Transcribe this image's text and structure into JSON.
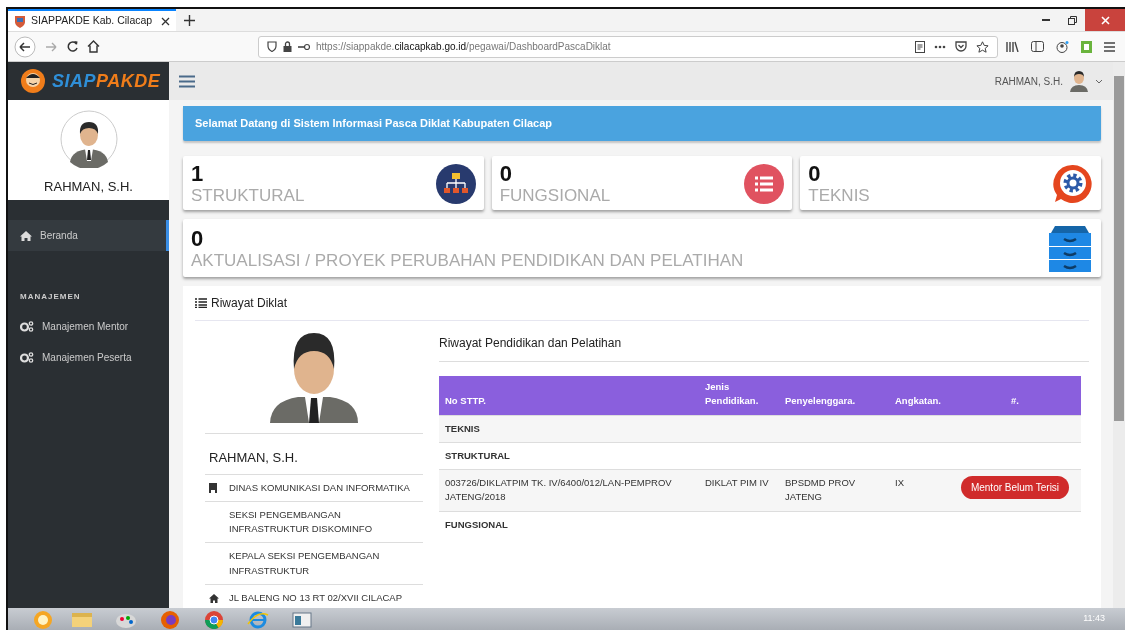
{
  "browser": {
    "tab_title": "SIAPPAKDE Kab. Cilacap",
    "url": "https://siappakde.**cilacapkab.go.id**/pegawai/DashboardPascaDiklat"
  },
  "app": {
    "logo": [
      {
        "text": "SIAP",
        "color": "#2f8fd8"
      },
      {
        "text": "PAKDE",
        "color": "#f07d1a"
      }
    ],
    "header_user": "RAHMAN, S.H.",
    "sidebar": {
      "profile_name": "RAHMAN, S.H.",
      "items": [
        {
          "label": "Beranda",
          "kind": "home",
          "selected": true
        }
      ],
      "section": "MANAJEMEN",
      "section_items": [
        {
          "label": "Manajemen Mentor",
          "kind": "gears",
          "selected": false
        },
        {
          "label": "Manajemen Peserta",
          "kind": "gears",
          "selected": false
        }
      ]
    },
    "welcome": "Selamat Datang di Sistem Informasi Pasca Diklat Kabupaten Cilacap",
    "stats": [
      {
        "value": "1",
        "label": "STRUKTURAL",
        "kind": "hierarchy"
      },
      {
        "value": "0",
        "label": "FUNGSIONAL",
        "kind": "list"
      },
      {
        "value": "0",
        "label": "TEKNIS",
        "kind": "gear"
      }
    ],
    "wide_stat": {
      "value": "0",
      "label": "AKTUALISASI / PROYEK PERUBAHAN PENDIDIKAN DAN PELATIHAN",
      "kind": "drawers"
    },
    "panel": {
      "title": "Riwayat Diklat",
      "profile": {
        "name": "RAHMAN, S.H.",
        "details": [
          {
            "kind": "office",
            "text": "DINAS KOMUNIKASI DAN INFORMATIKA"
          },
          {
            "kind": "plain",
            "text": "SEKSI PENGEMBANGAN INFRASTRUKTUR DISKOMINFO"
          },
          {
            "kind": "plain",
            "text": "KEPALA SEKSI PENGEMBANGAN INFRASTRUKTUR"
          },
          {
            "kind": "address",
            "text": "JL BALENG NO 13 RT 02/XVII CILACAP"
          }
        ]
      },
      "table": {
        "title": "Riwayat Pendidikan dan Pelatihan",
        "columns": [
          "No STTP.",
          "Jenis Pendidikan.",
          "Penyelenggara.",
          "Angkatan.",
          "#."
        ],
        "rows": [
          {
            "kind": "group",
            "label": "TEKNIS"
          },
          {
            "kind": "group",
            "label": "STRUKTURAL"
          },
          {
            "kind": "data",
            "cells": [
              "003726/DIKLATPIM TK. IV/6400/012/LAN-PEMPROV JATENG/2018",
              "DIKLAT PIM IV",
              "BPSDMD PROV JATENG",
              "IX"
            ],
            "action": "Mentor Belum Terisi"
          },
          {
            "kind": "group",
            "label": "FUNGSIONAL"
          }
        ]
      }
    }
  },
  "taskbar": {
    "time": "11:43"
  }
}
